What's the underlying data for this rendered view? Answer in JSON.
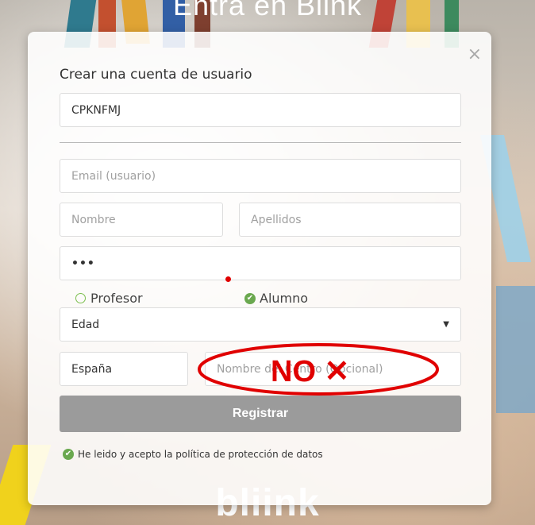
{
  "page": {
    "top_title": "Entra en Blink",
    "bottom_logo": "bliink"
  },
  "modal": {
    "title": "Crear una cuenta de usuario",
    "close_label": "×",
    "code_value": "CPKNFMJ",
    "email_placeholder": "Email (usuario)",
    "nombre_placeholder": "Nombre",
    "apellidos_placeholder": "Apellidos",
    "password_value": "•••",
    "role_options": [
      {
        "label": "Profesor",
        "selected": false
      },
      {
        "label": "Alumno",
        "selected": true
      }
    ],
    "edad_selected": "Edad",
    "pais_value": "España",
    "centro_placeholder": "Nombre del Centro (Opcional)",
    "register_label": "Registrar",
    "terms_label": "He leido y acepto la política de protección de datos"
  },
  "annotation": {
    "text": "NO ✕",
    "color": "#e00000"
  },
  "colors": {
    "accent_green": "#6aa84f",
    "button_gray": "#9b9b9b"
  }
}
